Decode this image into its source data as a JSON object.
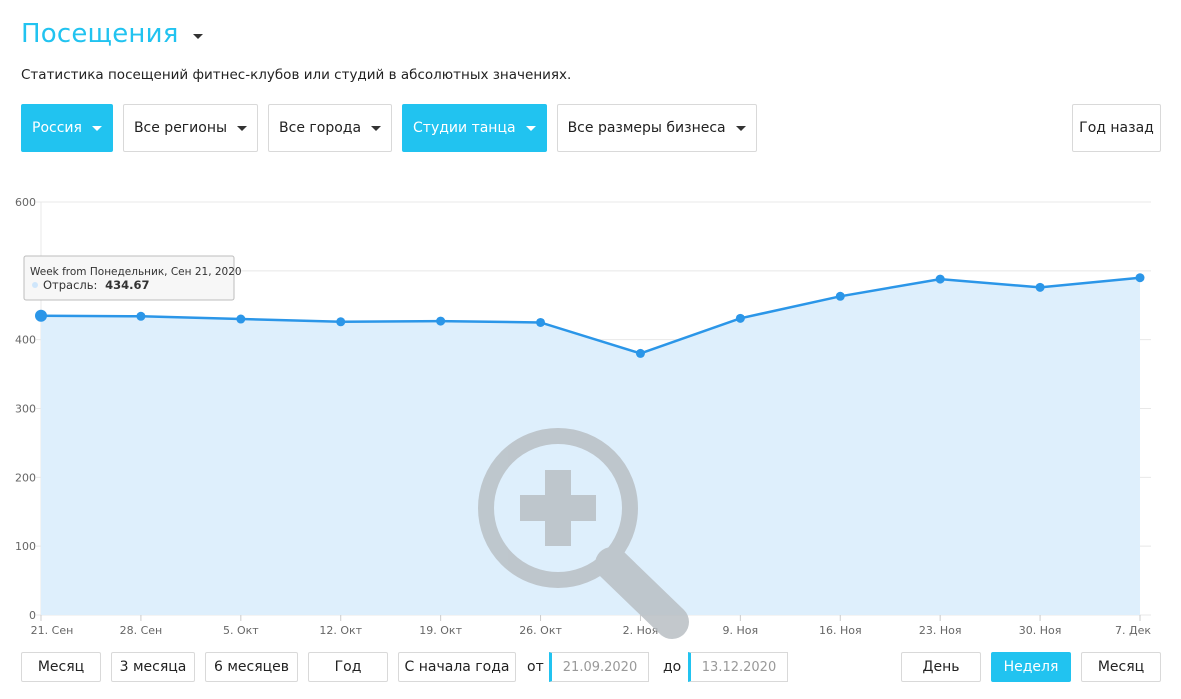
{
  "header": {
    "title": "Посещения",
    "subtitle": "Статистика посещений фитнес-клубов или студий в абсолютных значениях."
  },
  "filters": {
    "country": "Россия",
    "region": "Все регионы",
    "city": "Все города",
    "category": "Студии танца",
    "business_size": "Все размеры бизнеса",
    "year_back": "Год назад"
  },
  "colors": {
    "accent": "#21c3f0",
    "line": "#2b96e8",
    "area": "#deeffc"
  },
  "chart_data": {
    "type": "area",
    "x": [
      "21. Сен",
      "28. Сен",
      "5. Окт",
      "12. Окт",
      "19. Окт",
      "26. Окт",
      "2. Ноя",
      "9. Ноя",
      "16. Ноя",
      "23. Ноя",
      "30. Ноя",
      "7. Дек"
    ],
    "series": [
      {
        "name": "Отрасль",
        "values": [
          434.67,
          434,
          430,
          426,
          427,
          425,
          380,
          431,
          463,
          488,
          476,
          490
        ]
      }
    ],
    "ylim": [
      0,
      600
    ],
    "yticks": [
      0,
      100,
      200,
      300,
      400,
      600
    ],
    "grid": true,
    "tooltip": {
      "header": "Week from Понедельник, Сен 21, 2020",
      "series_label": "Отрасль:",
      "value": "434.67",
      "index": 0
    },
    "overlay_icon": "zoom-in-icon"
  },
  "period": {
    "month": "Месяц",
    "three_months": "3 месяца",
    "six_months": "6 месяцев",
    "year": "Год",
    "ytd": "С начала года",
    "from_label": "от",
    "from_value": "21.09.2020",
    "to_label": "до",
    "to_value": "13.12.2020"
  },
  "granularity": {
    "day": "День",
    "week": "Неделя",
    "month": "Месяц",
    "selected": "week"
  }
}
